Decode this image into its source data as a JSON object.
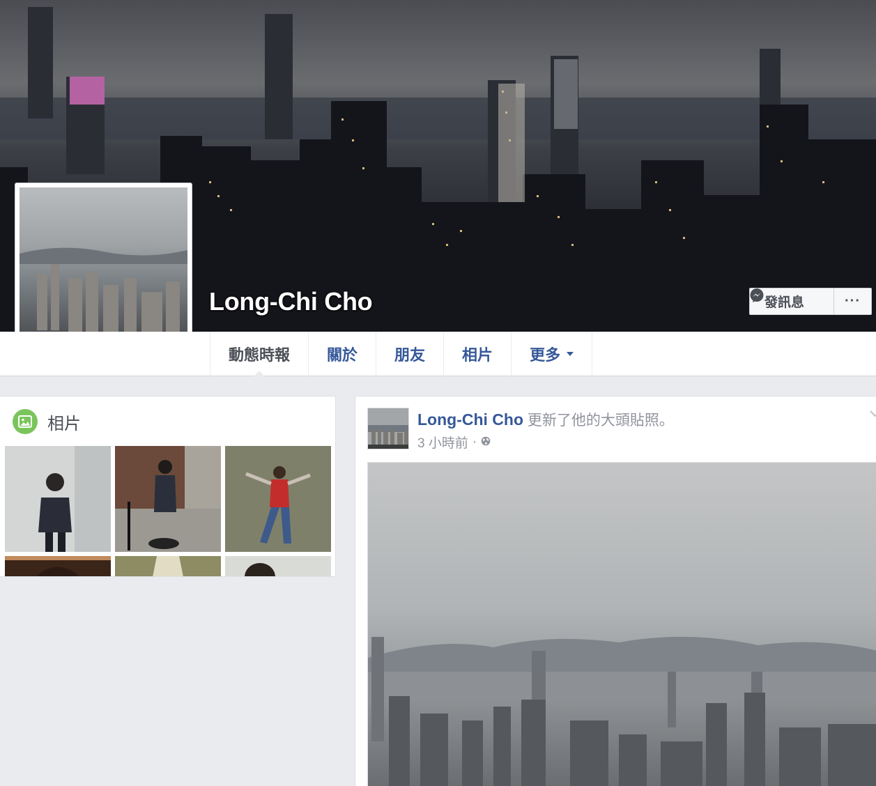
{
  "cover": {
    "name": "Long-Chi Cho",
    "message_button": "發訊息",
    "more_button": "···"
  },
  "nav": {
    "tabs": [
      {
        "label": "動態時報"
      },
      {
        "label": "關於"
      },
      {
        "label": "朋友"
      },
      {
        "label": "相片"
      },
      {
        "label": "更多"
      }
    ]
  },
  "photos": {
    "title": "相片"
  },
  "post": {
    "author": "Long-Chi Cho",
    "action": " 更新了他的大頭貼照。",
    "time": "3 小時前",
    "separator": "·"
  },
  "colors": {
    "link": "#365899",
    "photos_icon": "#7ac55b",
    "page_bg": "#e9ebee"
  }
}
